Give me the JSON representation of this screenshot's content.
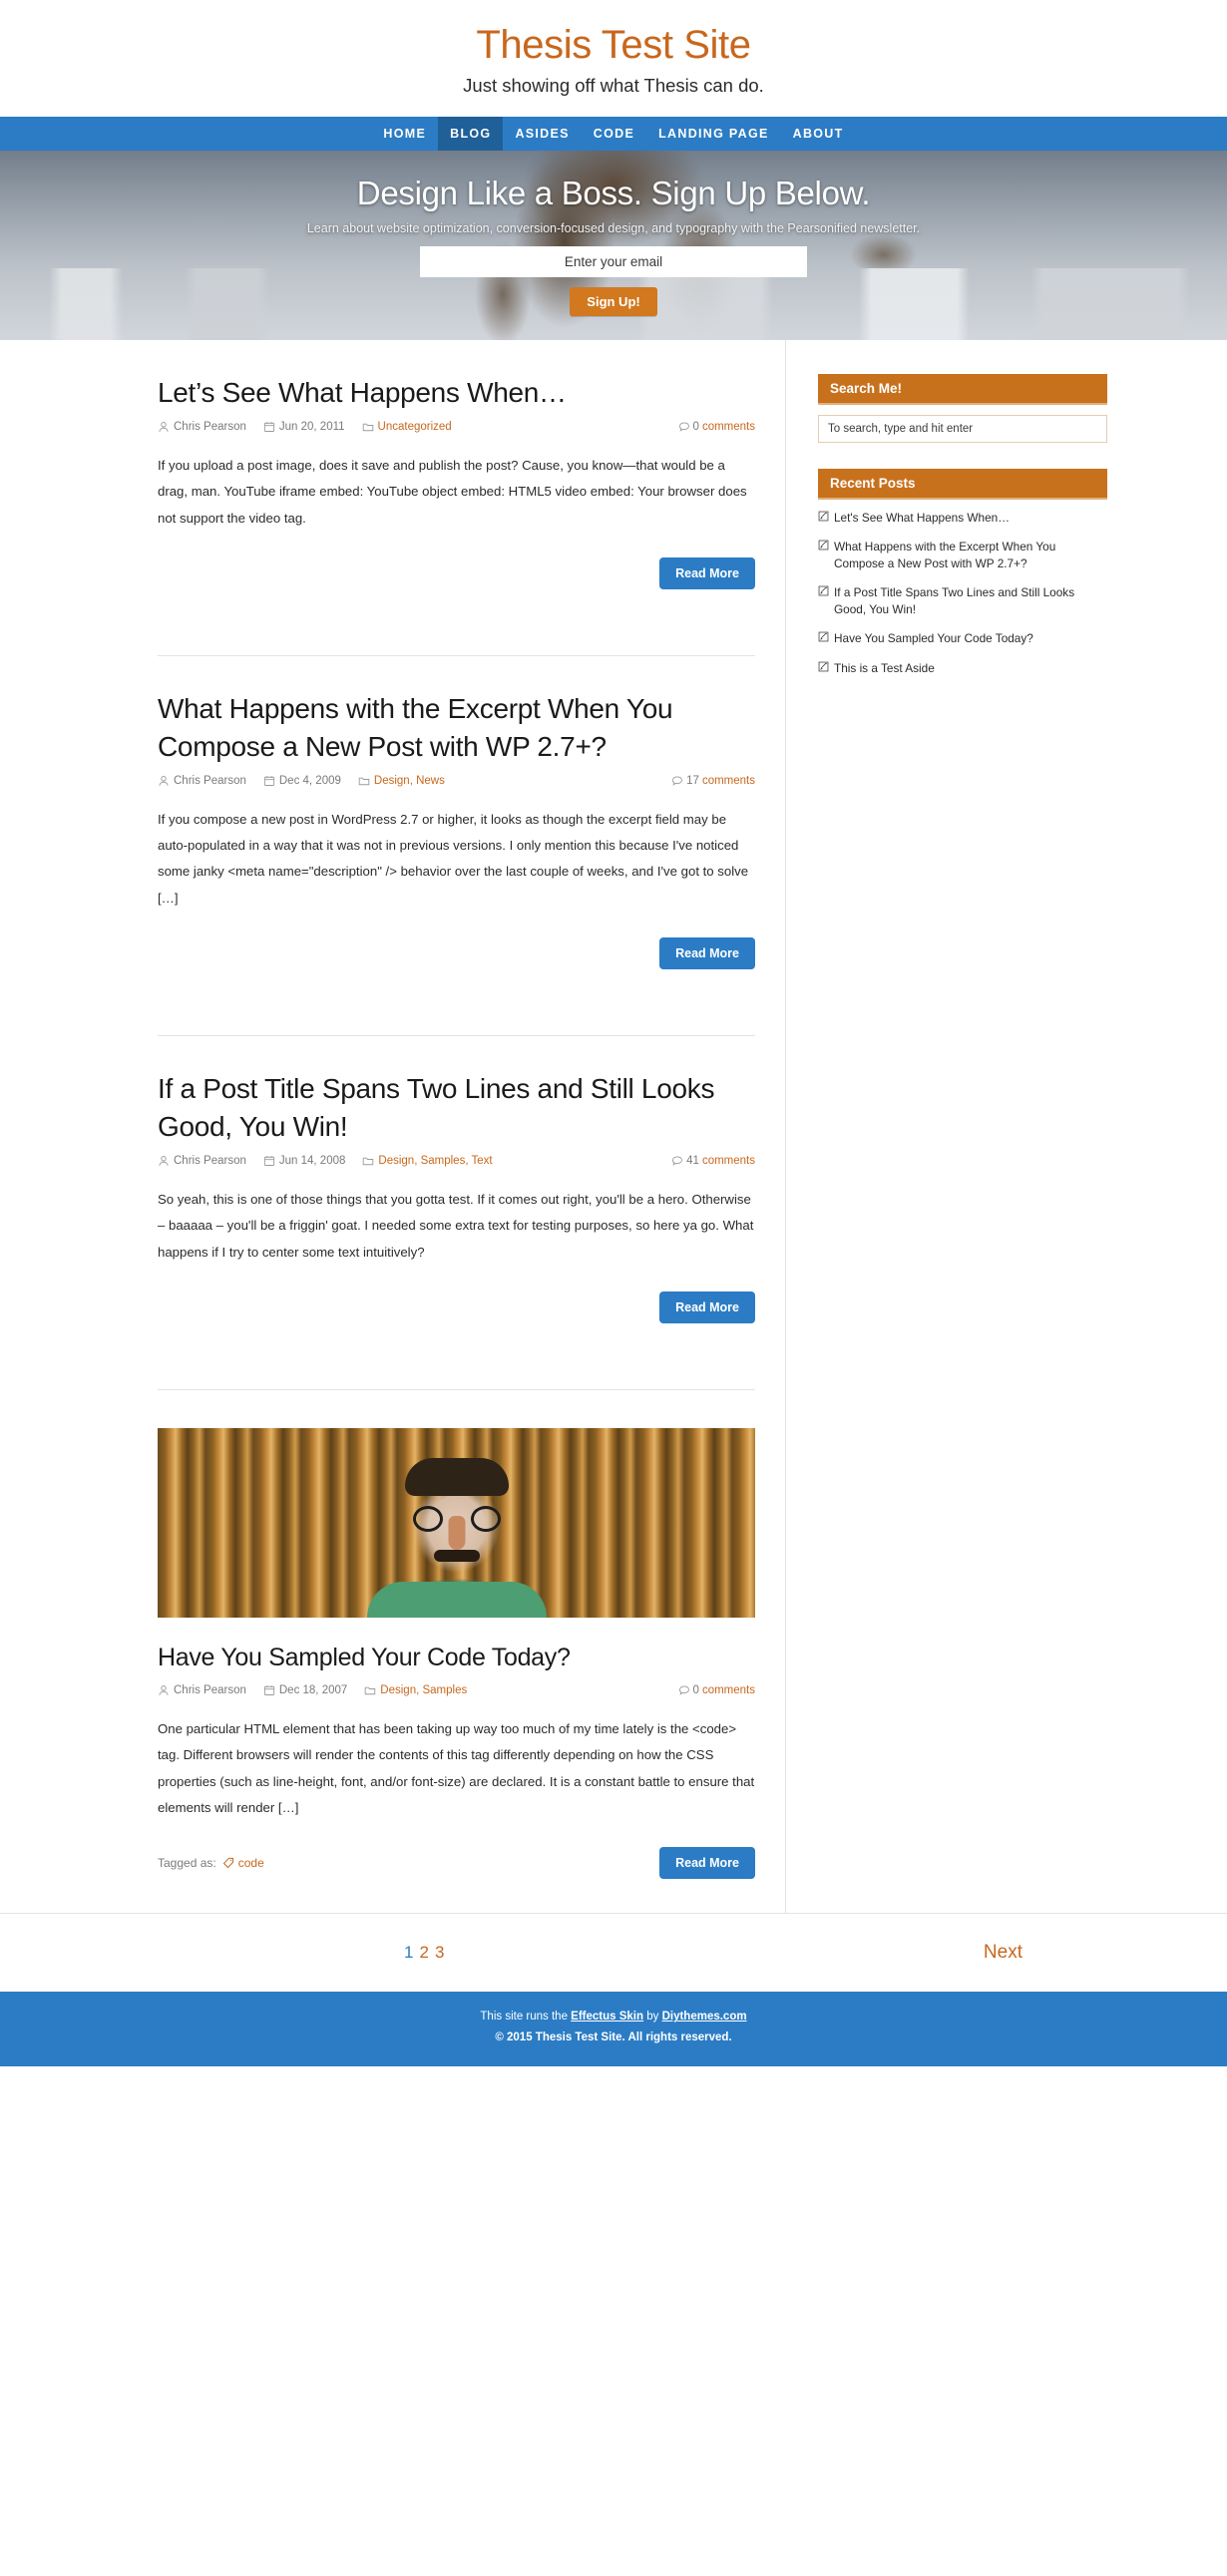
{
  "header": {
    "title": "Thesis Test Site",
    "tagline": "Just showing off what Thesis can do."
  },
  "nav": {
    "items": [
      {
        "label": "HOME",
        "active": false
      },
      {
        "label": "BLOG",
        "active": true
      },
      {
        "label": "ASIDES",
        "active": false
      },
      {
        "label": "CODE",
        "active": false
      },
      {
        "label": "LANDING PAGE",
        "active": false
      },
      {
        "label": "ABOUT",
        "active": false
      }
    ]
  },
  "hero": {
    "headline": "Design Like a Boss. Sign Up Below.",
    "subhead": "Learn about website optimization, conversion-focused design, and typography with the Pearsonified newsletter.",
    "email_placeholder": "Enter your email",
    "email_value": "",
    "submit_label": "Sign Up!"
  },
  "posts": [
    {
      "title": "Let’s See What Happens When…",
      "author": "Chris Pearson",
      "date": "Jun 20, 2011",
      "categories": "Uncategorized",
      "comment_count": "0",
      "comment_label": "comments",
      "excerpt": "If you upload a post image, does it save and publish the post? Cause, you know—that would be a drag, man. YouTube iframe embed: YouTube object embed: HTML5 video embed: Your browser does not support the video tag.",
      "read_more": "Read More",
      "tagged_label": "",
      "tag": "",
      "has_image": false
    },
    {
      "title": "What Happens with the Excerpt When You Compose a New Post with WP 2.7+?",
      "author": "Chris Pearson",
      "date": "Dec 4, 2009",
      "categories": "Design, News",
      "comment_count": "17",
      "comment_label": "comments",
      "excerpt": "If you compose a new post in WordPress 2.7 or higher, it looks as though the excerpt field may be auto-populated in a way that it was not in previous versions. I only mention this because I've noticed some janky <meta name=\"description\" /> behavior over the last couple of weeks, and I've got to solve […]",
      "read_more": "Read More",
      "tagged_label": "",
      "tag": "",
      "has_image": false
    },
    {
      "title": "If a Post Title Spans Two Lines and Still Looks Good, You Win!",
      "author": "Chris Pearson",
      "date": "Jun 14, 2008",
      "categories": "Design, Samples, Text",
      "comment_count": "41",
      "comment_label": "comments",
      "excerpt": "So yeah, this is one of those things that you gotta test. If it comes out right, you'll be a hero. Otherwise – baaaaa – you'll be a friggin' goat. I needed some extra text for testing purposes, so here ya go. What happens if I try to center some text intuitively?",
      "read_more": "Read More",
      "tagged_label": "",
      "tag": "",
      "has_image": false
    },
    {
      "title": "Have You Sampled Your Code Today?",
      "author": "Chris Pearson",
      "date": "Dec 18, 2007",
      "categories": "Design, Samples",
      "comment_count": "0",
      "comment_label": "comments",
      "excerpt": "One particular HTML element that has been taking up way too much of my time lately is the <code> tag. Different browsers will render the contents of this tag differently depending on how the CSS properties (such as line-height, font, and/or font-size) are declared. It is a constant battle to ensure that elements will render […]",
      "read_more": "Read More",
      "tagged_label": "Tagged as:",
      "tag": "code",
      "has_image": true
    }
  ],
  "sidebar": {
    "search_widget": {
      "title": "Search Me!",
      "placeholder": "To search, type and hit enter",
      "value": ""
    },
    "recent_widget": {
      "title": "Recent Posts",
      "items": [
        "Let's See What Happens When…",
        "What Happens with the Excerpt When You Compose a New Post with WP 2.7+?",
        "If a Post Title Spans Two Lines and Still Looks Good, You Win!",
        "Have You Sampled Your Code Today?",
        "This is a Test Aside"
      ]
    }
  },
  "pagination": {
    "pages": [
      "1",
      "2",
      "3"
    ],
    "current": "1",
    "next_label": "Next"
  },
  "footer": {
    "line1_pre": "This site runs the ",
    "skin_link": "Effectus Skin",
    "line1_mid": " by ",
    "vendor_link": "Diythemes.com",
    "line2": "© 2015 Thesis Test Site. All rights reserved."
  },
  "colors": {
    "brand_orange": "#c8671d",
    "nav_blue": "#2b7cc4",
    "nav_active_blue": "#1f6099",
    "widget_orange": "#c8711d",
    "button_blue": "#2b7cc4",
    "signup_orange": "#d2781e"
  }
}
